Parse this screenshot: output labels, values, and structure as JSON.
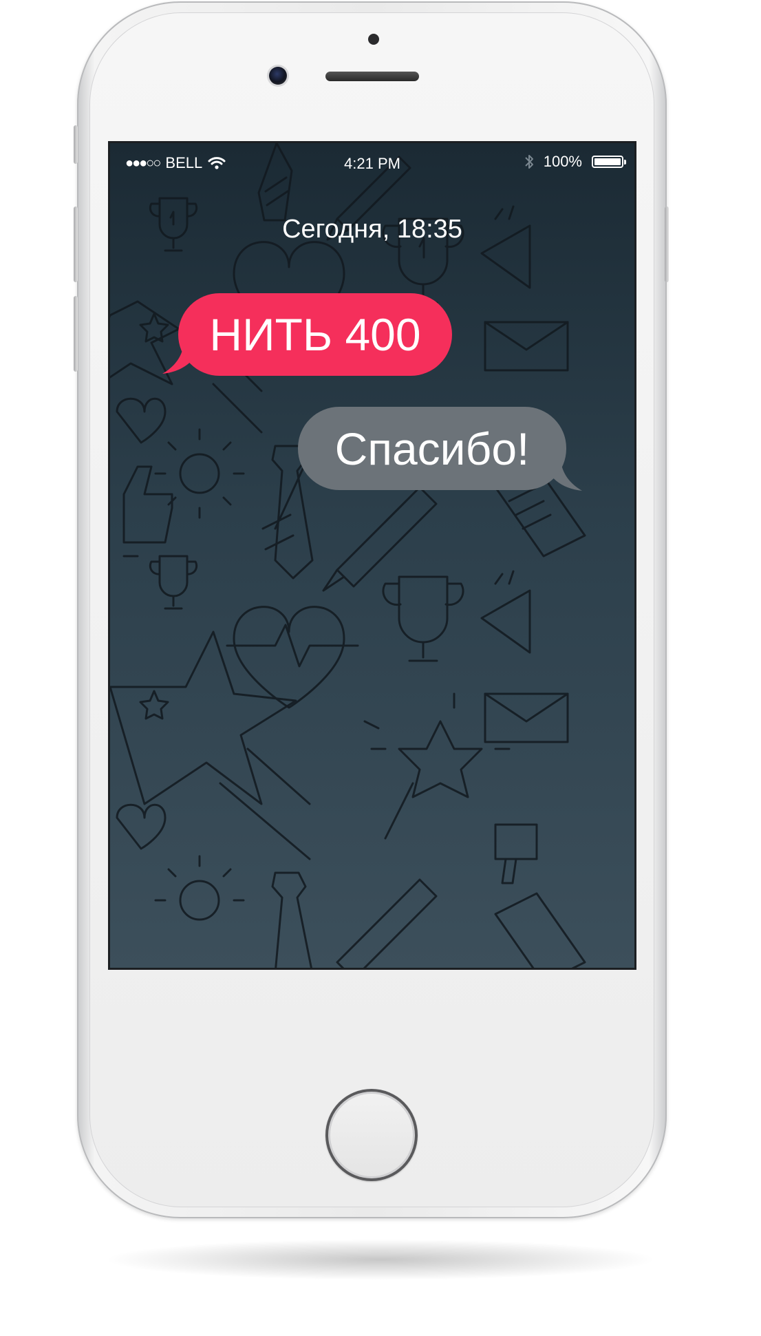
{
  "status_bar": {
    "carrier": "BELL",
    "time": "4:21 PM",
    "battery_percent_text": "100%",
    "battery_level": 1.0,
    "signal_icon": "signal-dots-icon",
    "wifi_icon": "wifi-icon",
    "bluetooth_icon": "bluetooth-icon",
    "battery_icon": "battery-icon"
  },
  "chat": {
    "date_label": "Сегодня, 18:35",
    "messages": [
      {
        "direction": "outgoing",
        "text": "НИТЬ 400",
        "color": "#f52f5b"
      },
      {
        "direction": "incoming",
        "text": "Спасибо!",
        "color": "#6c7379"
      }
    ]
  },
  "colors": {
    "screen_top": "#1b2a34",
    "screen_bottom": "#3c4f5b",
    "accent": "#f52f5b",
    "bubble_gray": "#6c7379",
    "pattern_stroke": "#12191f"
  },
  "background_pattern_icons": [
    "trophy-icon",
    "tie-icon",
    "pen-icon",
    "heart-icon",
    "star-icon",
    "envelope-icon",
    "megaphone-icon",
    "sun-icon",
    "thumbs-up-icon",
    "document-icon",
    "magic-wand-icon"
  ]
}
